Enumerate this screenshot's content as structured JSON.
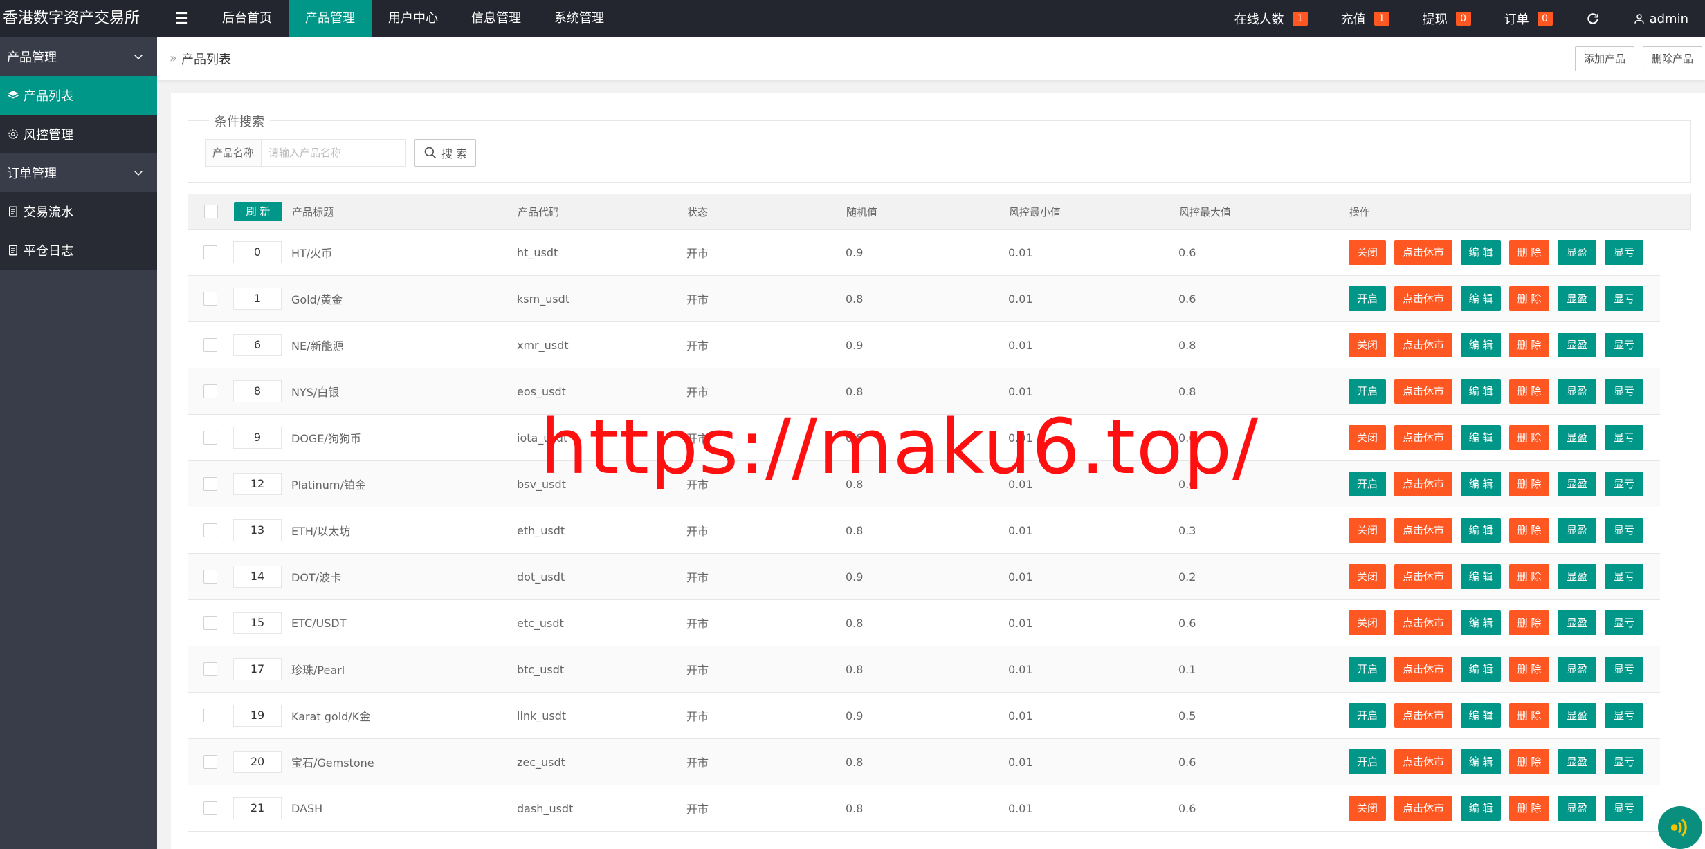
{
  "app": {
    "title": "香港数字资产交易所"
  },
  "topnav": [
    {
      "label": "后台首页",
      "active": false
    },
    {
      "label": "产品管理",
      "active": true
    },
    {
      "label": "用户中心",
      "active": false
    },
    {
      "label": "信息管理",
      "active": false
    },
    {
      "label": "系统管理",
      "active": false
    }
  ],
  "header_right": {
    "online": {
      "label": "在线人数",
      "count": "1"
    },
    "recharge": {
      "label": "充值",
      "count": "1"
    },
    "withdraw": {
      "label": "提现",
      "count": "0"
    },
    "orders": {
      "label": "订单",
      "count": "0"
    },
    "user": "admin"
  },
  "sidebar": {
    "group1": "产品管理",
    "items1": [
      {
        "label": "产品列表",
        "icon": "layers-icon",
        "active": true
      },
      {
        "label": "风控管理",
        "icon": "gear-icon",
        "active": false
      }
    ],
    "group2": "订单管理",
    "items2": [
      {
        "label": "交易流水",
        "icon": "document-icon",
        "active": false
      },
      {
        "label": "平仓日志",
        "icon": "document-icon",
        "active": false
      }
    ]
  },
  "breadcrumb": {
    "current": "产品列表",
    "add_label": "添加产品",
    "delete_label": "删除产品"
  },
  "search": {
    "legend": "条件搜索",
    "label": "产品名称",
    "placeholder": "请输入产品名称",
    "button": "搜 索"
  },
  "table": {
    "refresh_label": "刷 新",
    "headers": {
      "title": "产品标题",
      "code": "产品代码",
      "status": "状态",
      "random": "随机值",
      "min": "风控最小值",
      "max": "风控最大值",
      "ops": "操作"
    },
    "op_labels": {
      "close": "关闭",
      "open": "开启",
      "rest": "点击休市",
      "edit": "编 辑",
      "delete": "删 除",
      "win": "显盈",
      "lose": "显亏"
    },
    "rows": [
      {
        "order": "0",
        "title": "HT/火币",
        "code": "ht_usdt",
        "status": "开市",
        "random": "0.9",
        "min": "0.01",
        "max": "0.6",
        "toggle": "close"
      },
      {
        "order": "1",
        "title": "Gold/黄金",
        "code": "ksm_usdt",
        "status": "开市",
        "random": "0.8",
        "min": "0.01",
        "max": "0.6",
        "toggle": "open"
      },
      {
        "order": "6",
        "title": "NE/新能源",
        "code": "xmr_usdt",
        "status": "开市",
        "random": "0.9",
        "min": "0.01",
        "max": "0.8",
        "toggle": "close"
      },
      {
        "order": "8",
        "title": "NYS/白银",
        "code": "eos_usdt",
        "status": "开市",
        "random": "0.8",
        "min": "0.01",
        "max": "0.8",
        "toggle": "open"
      },
      {
        "order": "9",
        "title": "DOGE/狗狗币",
        "code": "iota_usdt",
        "status": "开市",
        "random": "0.8",
        "min": "0.01",
        "max": "0.6",
        "toggle": "close"
      },
      {
        "order": "12",
        "title": "Platinum/铂金",
        "code": "bsv_usdt",
        "status": "开市",
        "random": "0.8",
        "min": "0.01",
        "max": "0.6",
        "toggle": "open"
      },
      {
        "order": "13",
        "title": "ETH/以太坊",
        "code": "eth_usdt",
        "status": "开市",
        "random": "0.8",
        "min": "0.01",
        "max": "0.3",
        "toggle": "close"
      },
      {
        "order": "14",
        "title": "DOT/波卡",
        "code": "dot_usdt",
        "status": "开市",
        "random": "0.9",
        "min": "0.01",
        "max": "0.2",
        "toggle": "close"
      },
      {
        "order": "15",
        "title": "ETC/USDT",
        "code": "etc_usdt",
        "status": "开市",
        "random": "0.8",
        "min": "0.01",
        "max": "0.6",
        "toggle": "close"
      },
      {
        "order": "17",
        "title": "珍珠/Pearl",
        "code": "btc_usdt",
        "status": "开市",
        "random": "0.8",
        "min": "0.01",
        "max": "0.1",
        "toggle": "open"
      },
      {
        "order": "19",
        "title": "Karat gold/K金",
        "code": "link_usdt",
        "status": "开市",
        "random": "0.9",
        "min": "0.01",
        "max": "0.5",
        "toggle": "open"
      },
      {
        "order": "20",
        "title": "宝石/Gemstone",
        "code": "zec_usdt",
        "status": "开市",
        "random": "0.8",
        "min": "0.01",
        "max": "0.6",
        "toggle": "open"
      },
      {
        "order": "21",
        "title": "DASH",
        "code": "dash_usdt",
        "status": "开市",
        "random": "0.8",
        "min": "0.01",
        "max": "0.6",
        "toggle": "close"
      }
    ]
  },
  "watermark": "https://maku6.top/",
  "colors": {
    "header": "#23262e",
    "sidebar": "#393d49",
    "primary": "#009688",
    "danger": "#ff5722"
  }
}
